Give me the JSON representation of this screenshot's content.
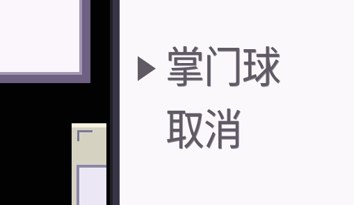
{
  "menu": {
    "items": [
      {
        "label": "掌门球",
        "selected": true
      },
      {
        "label": "取消",
        "selected": false
      }
    ]
  },
  "icons": {
    "selection": "selection-cursor-icon"
  },
  "colors": {
    "field_background": "#020202",
    "menu_background": "#fbf8fc",
    "text": "#5f5a64",
    "panel_border": "#a397b4"
  }
}
